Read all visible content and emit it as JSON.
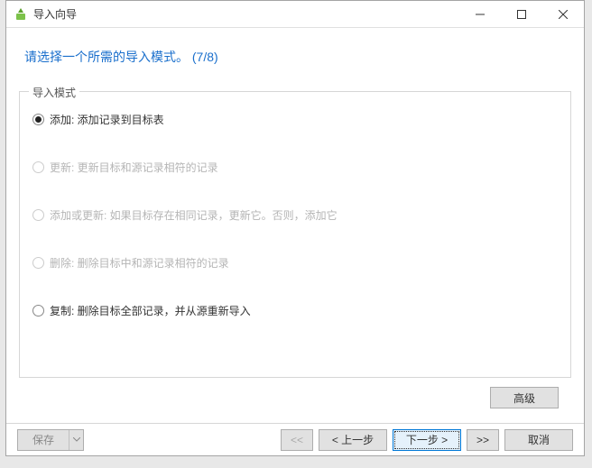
{
  "window": {
    "title": "导入向导"
  },
  "heading": "请选择一个所需的导入模式。 (7/8)",
  "fieldset_legend": "导入模式",
  "options": [
    {
      "label": "添加: 添加记录到目标表",
      "selected": true,
      "disabled": false
    },
    {
      "label": "更新: 更新目标和源记录相符的记录",
      "selected": false,
      "disabled": true
    },
    {
      "label": "添加或更新: 如果目标存在相同记录，更新它。否则，添加它",
      "selected": false,
      "disabled": true
    },
    {
      "label": "删除: 删除目标中和源记录相符的记录",
      "selected": false,
      "disabled": true
    },
    {
      "label": "复制: 删除目标全部记录，并从源重新导入",
      "selected": false,
      "disabled": false
    }
  ],
  "buttons": {
    "advanced": "高级",
    "save": "保存",
    "first": "<<",
    "prev": "< 上一步",
    "next": "下一步 >",
    "last": ">>",
    "cancel": "取消"
  }
}
